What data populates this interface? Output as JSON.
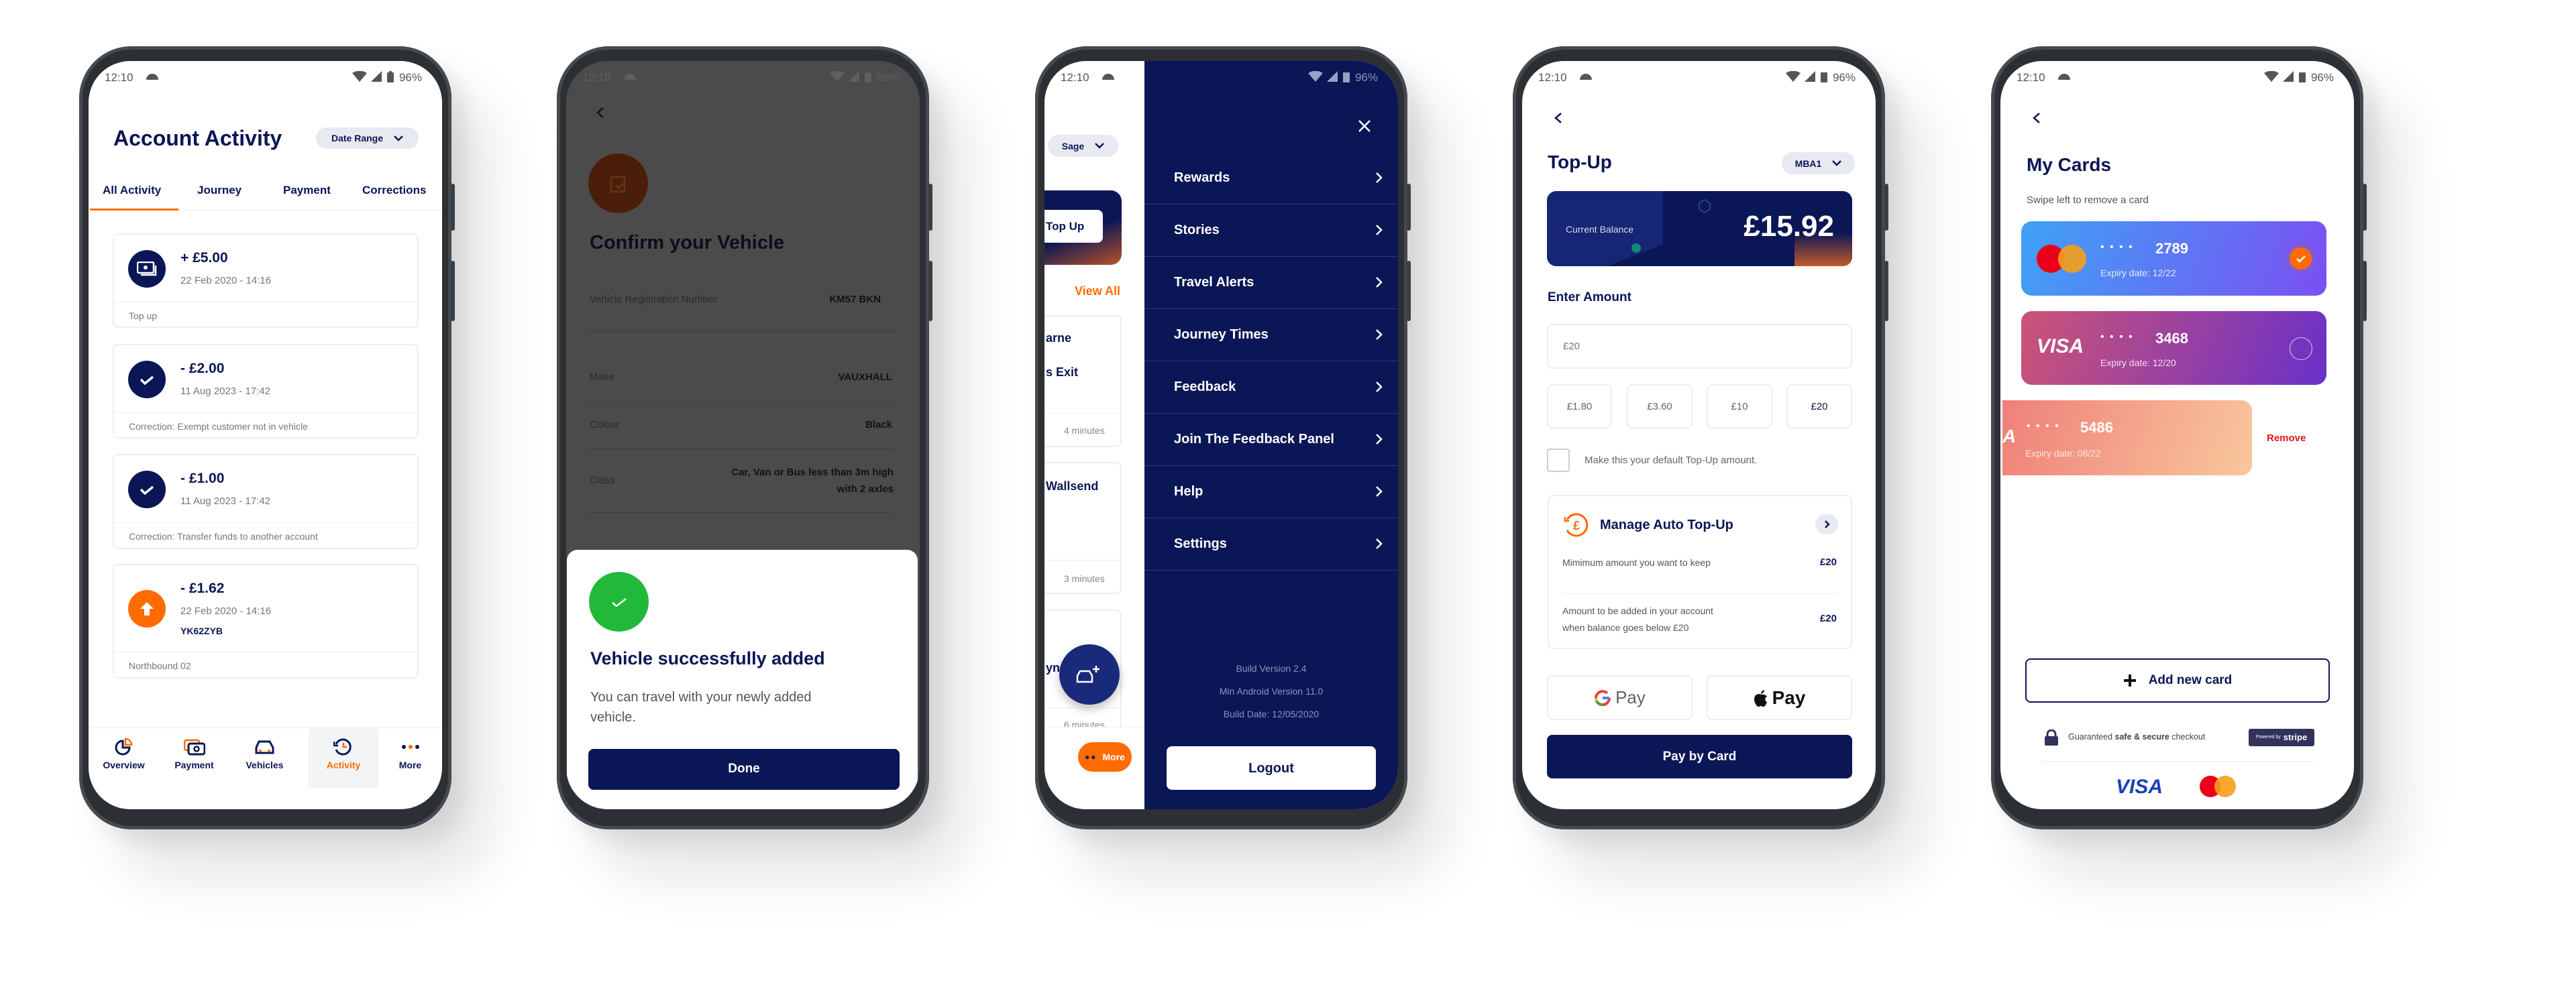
{
  "status": {
    "time": "12:10",
    "battery": "96%"
  },
  "activity": {
    "title": "Account Activity",
    "date_range": "Date Range",
    "tabs": [
      "All Activity",
      "Journey",
      "Payment",
      "Corrections"
    ],
    "active_tab": "All Activity",
    "items": [
      {
        "amount": "+ £5.00",
        "date": "22 Feb 2020 - 14:16",
        "note": "Top up",
        "icon": "top-up-icon"
      },
      {
        "amount": "- £2.00",
        "date": "11 Aug 2023 - 17:42",
        "note": "Correction: Exempt customer not in vehicle",
        "icon": "check-icon"
      },
      {
        "amount": "- £1.00",
        "date": "11 Aug 2023 - 17:42",
        "note": "Correction: Transfer funds to another account",
        "icon": "check-icon"
      },
      {
        "amount": "- £1.62",
        "date": "22 Feb 2020 - 14:16",
        "plate": "YK62ZYB",
        "note": "Northbound 02",
        "icon": "arrow-up-icon"
      }
    ],
    "nav": [
      "Overview",
      "Payment",
      "Vehicles",
      "Activity",
      "More"
    ],
    "active_nav": "Activity",
    "accent": "#ff6b00",
    "navy": "#0b1656"
  },
  "vehicle": {
    "title": "Confirm your Vehicle",
    "rows": [
      {
        "label": "Vehicle Registration Number",
        "value": "KM57 BKN"
      },
      {
        "label": "Make",
        "value": "VAUXHALL"
      },
      {
        "label": "Colour",
        "value": "Black"
      },
      {
        "label": "Class",
        "value": "Car, Van or Bus less than 3m high",
        "value2": "with 2 axles"
      }
    ],
    "sheet": {
      "title": "Vehicle successfully added",
      "body1": "You can travel with your newly added",
      "body2": "vehicle.",
      "done": "Done"
    },
    "success_color": "#22b83a"
  },
  "menu": {
    "behind": {
      "account": "Sage",
      "top_up": "Top Up",
      "view_all": "View All",
      "journeys": [
        {
          "l1": "arne",
          "l2": "s Exit",
          "time": "4 minutes"
        },
        {
          "l1": "Wallsend",
          "time": "3 minutes"
        },
        {
          "l1": "yn",
          "time": "6 minutes"
        }
      ],
      "more": "More"
    },
    "items": [
      "Rewards",
      "Stories",
      "Travel Alerts",
      "Journey Times",
      "Feedback",
      "Join The Feedback Panel",
      "Help",
      "Settings"
    ],
    "build": [
      "Build Version 2.4",
      "Min Android Version 11.0",
      "Build Date: 12/05/2020"
    ],
    "logout": "Logout"
  },
  "topup": {
    "title": "Top-Up",
    "account": "MBA1",
    "balance_label": "Current Balance",
    "balance": "£15.92",
    "enter_amount": "Enter Amount",
    "amount_placeholder": "£20",
    "quick": [
      "£1.80",
      "£3.60",
      "£10",
      "£20"
    ],
    "selected_quick": "£20",
    "default_label": "Make this your default Top-Up amount.",
    "default_checked": false,
    "auto": {
      "title": "Manage Auto Top-Up",
      "min_label": "Mimimum amount you want to keep",
      "min_value": "£20",
      "add_label1": "Amount to be added in your account",
      "add_label2": "when balance goes below £20",
      "add_value": "£20"
    },
    "gpay": "Pay",
    "applepay": "Pay",
    "pay_card": "Pay by Card"
  },
  "cards": {
    "title": "My Cards",
    "subtitle": "Swipe left to remove a card",
    "list": [
      {
        "brand": "mastercard",
        "dots": "• • • •",
        "last4": "2789",
        "expiry": "Expiry date: 12/22",
        "selected": true
      },
      {
        "brand": "VISA",
        "dots": "• • • •",
        "last4": "3468",
        "expiry": "Expiry date: 12/20",
        "selected": false
      },
      {
        "brand": "A",
        "dots": "• • • •",
        "last4": "5486",
        "expiry": "Expiry date: 08/22",
        "selected": false
      }
    ],
    "remove": "Remove",
    "add": "Add new card",
    "secure_pre": "Guaranteed ",
    "secure_bold": "safe & secure",
    "secure_post": " checkout",
    "powered": "Powered by",
    "stripe": "stripe",
    "footer_visa": "VISA"
  }
}
